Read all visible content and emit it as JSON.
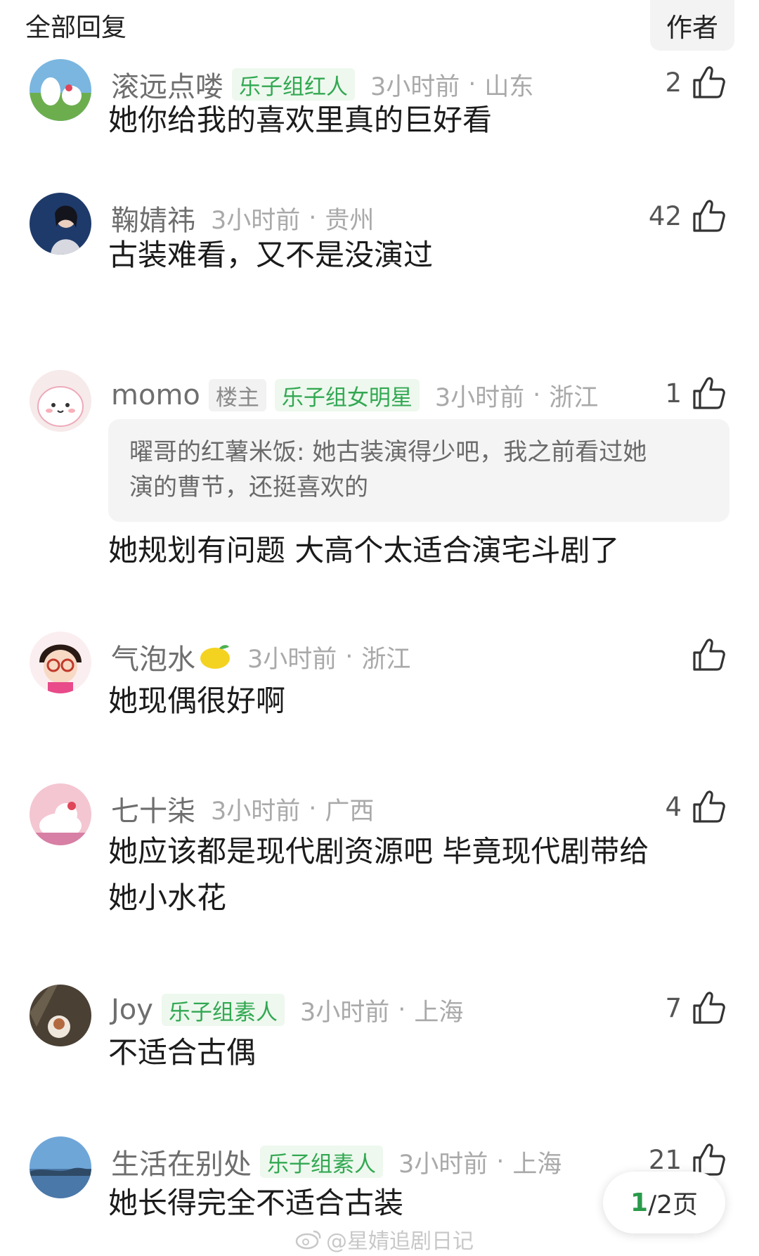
{
  "header": {
    "title": "全部回复",
    "author_tab": "作者"
  },
  "comments": [
    {
      "name": "滚远点喽",
      "badges": [
        "乐子组红人"
      ],
      "time": "3小时前",
      "location": "山东",
      "likes": "2",
      "text": "她你给我的喜欢里真的巨好看"
    },
    {
      "name": "鞠婧祎",
      "badges": [],
      "time": "3小时前",
      "location": "贵州",
      "likes": "42",
      "text": "古装难看，又不是没演过"
    },
    {
      "name": "momo",
      "op_badge": "楼主",
      "badges": [
        "乐子组女明星"
      ],
      "time": "3小时前",
      "location": "浙江",
      "likes": "1",
      "quote_line1": "曜哥的红薯米饭: 她古装演得少吧，我之前看过她",
      "quote_line2": "演的曹节，还挺喜欢的",
      "text": "她规划有问题 大高个太适合演宅斗剧了"
    },
    {
      "name": "气泡水",
      "badges": [],
      "time": "3小时前",
      "location": "浙江",
      "likes": "",
      "text": "她现偶很好啊"
    },
    {
      "name": "七十柒",
      "badges": [],
      "time": "3小时前",
      "location": "广西",
      "likes": "4",
      "text_line1": "她应该都是现代剧资源吧 毕竟现代剧带给",
      "text_line2": "她小水花"
    },
    {
      "name": "Joy",
      "badges": [
        "乐子组素人"
      ],
      "time": "3小时前",
      "location": "上海",
      "likes": "7",
      "text": "不适合古偶"
    },
    {
      "name": "生活在别处",
      "badges": [
        "乐子组素人"
      ],
      "time": "3小时前",
      "location": "上海",
      "likes": "21",
      "text": "她长得完全不适合古装"
    }
  ],
  "separator": "·",
  "pager": {
    "current": "1",
    "total_text": "/2页"
  },
  "watermark": "@星婧追剧日记",
  "colors": {
    "badge_green": "#32a852",
    "badge_bg": "#eef8ee",
    "page_current": "#2a9a4a"
  },
  "icons": {
    "like": "thumbs-up-icon",
    "weibo": "weibo-logo-icon"
  }
}
